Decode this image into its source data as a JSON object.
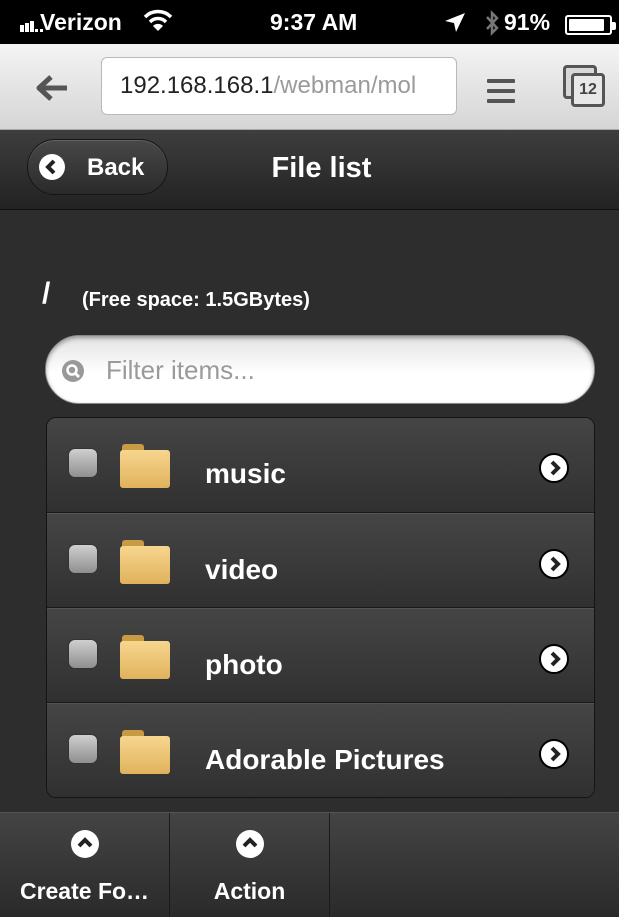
{
  "status_bar": {
    "carrier": "Verizon",
    "time": "9:37 AM",
    "battery_percent": "91%",
    "battery_level": 0.91,
    "icons": [
      "signal-icon",
      "wifi-icon",
      "location-icon",
      "bluetooth-icon",
      "battery-icon"
    ]
  },
  "browser": {
    "url_host": "192.168.168.1",
    "url_path": "/webman/mol",
    "tab_count": "12",
    "icons": [
      "back-arrow-icon",
      "menu-icon",
      "tabs-icon"
    ]
  },
  "header": {
    "back_label": "Back",
    "title": "File list"
  },
  "content": {
    "path": "/",
    "free_space": "(Free space: 1.5GBytes)",
    "filter_placeholder": "Filter items...",
    "items": [
      {
        "name": "music",
        "icon": "folder-icon"
      },
      {
        "name": "video",
        "icon": "folder-icon"
      },
      {
        "name": "photo",
        "icon": "folder-icon"
      },
      {
        "name": "Adorable Pictures",
        "icon": "folder-icon"
      }
    ]
  },
  "footer": {
    "create_folder_label": "Create Fo…",
    "action_label": "Action"
  },
  "colors": {
    "status_bg": "#000000",
    "header_bg": "#2a2a2a",
    "content_bg": "#2d2d2d",
    "folder": "#f0c877",
    "url_host": "#222222",
    "url_path": "#9a9a9a"
  }
}
